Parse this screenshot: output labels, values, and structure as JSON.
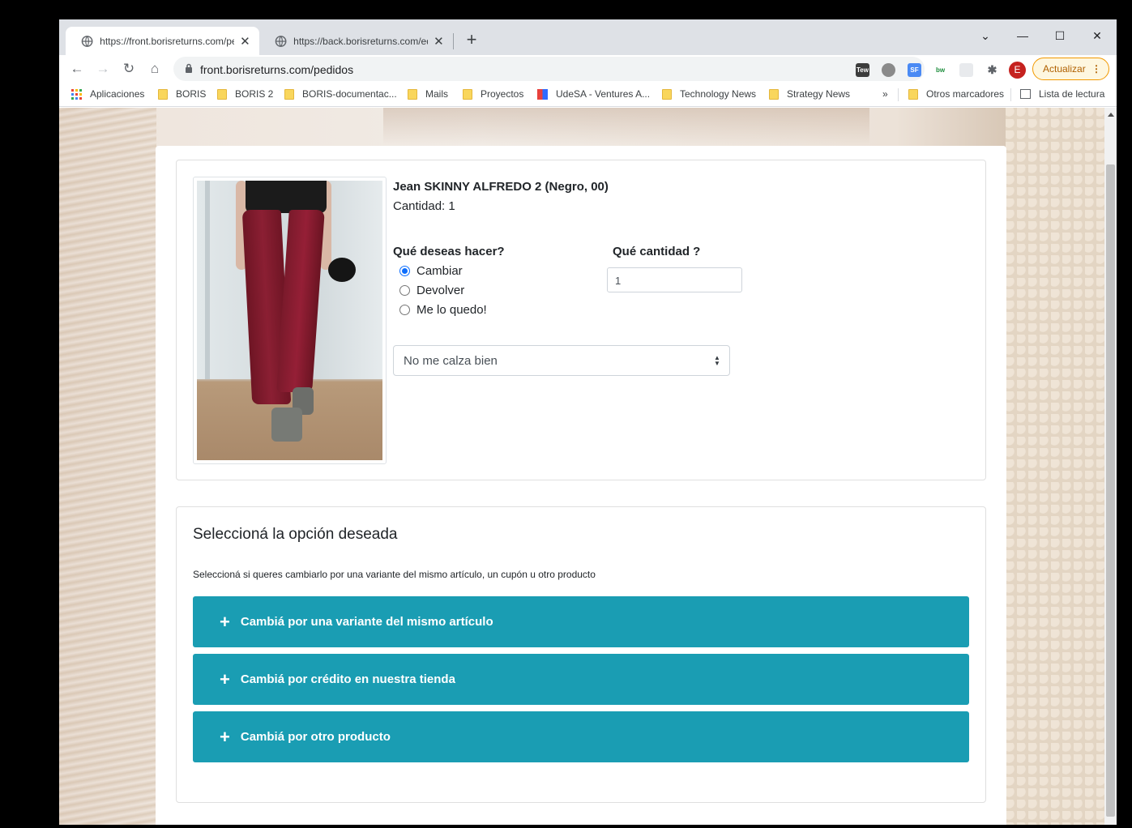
{
  "browser": {
    "tabs": [
      {
        "title": "https://front.borisreturns.com/pe",
        "active": true
      },
      {
        "title": "https://back.borisreturns.com/ed",
        "active": false
      }
    ],
    "new_tab": "+",
    "url": "front.borisreturns.com/pedidos",
    "profile_initial": "E",
    "update_label": "Actualizar",
    "extensions": [
      "Tew",
      "SF",
      "bw"
    ],
    "bookmarks": [
      "Aplicaciones",
      "BORIS",
      "BORIS 2",
      "BORIS-documentac...",
      "Mails",
      "Proyectos",
      "UdeSA - Ventures A...",
      "Technology News",
      "Strategy News"
    ],
    "more_bookmarks": "»",
    "other_bookmarks": "Otros marcadores",
    "reading_list": "Lista de lectura"
  },
  "product": {
    "name": "Jean SKINNY ALFREDO 2 (Negro, 00)",
    "quantity_text": "Cantidad: 1",
    "action_label": "Qué deseas hacer?",
    "actions": [
      {
        "label": "Cambiar",
        "checked": true
      },
      {
        "label": "Devolver",
        "checked": false
      },
      {
        "label": "Me lo quedo!",
        "checked": false
      }
    ],
    "amount_label": "Qué cantidad ?",
    "amount_value": "1",
    "reason_selected": "No me calza bien"
  },
  "options": {
    "title": "Seleccioná la opción deseada",
    "description": "Seleccioná si queres cambiarlo por una variante del mismo artículo, un cupón u otro producto",
    "buttons": [
      "Cambiá por una variante del mismo artículo",
      "Cambiá por crédito en nuestra tienda",
      "Cambiá por otro producto"
    ]
  },
  "colors": {
    "accordion": "#1a9db3",
    "radio_checked": "#0d6efd"
  }
}
